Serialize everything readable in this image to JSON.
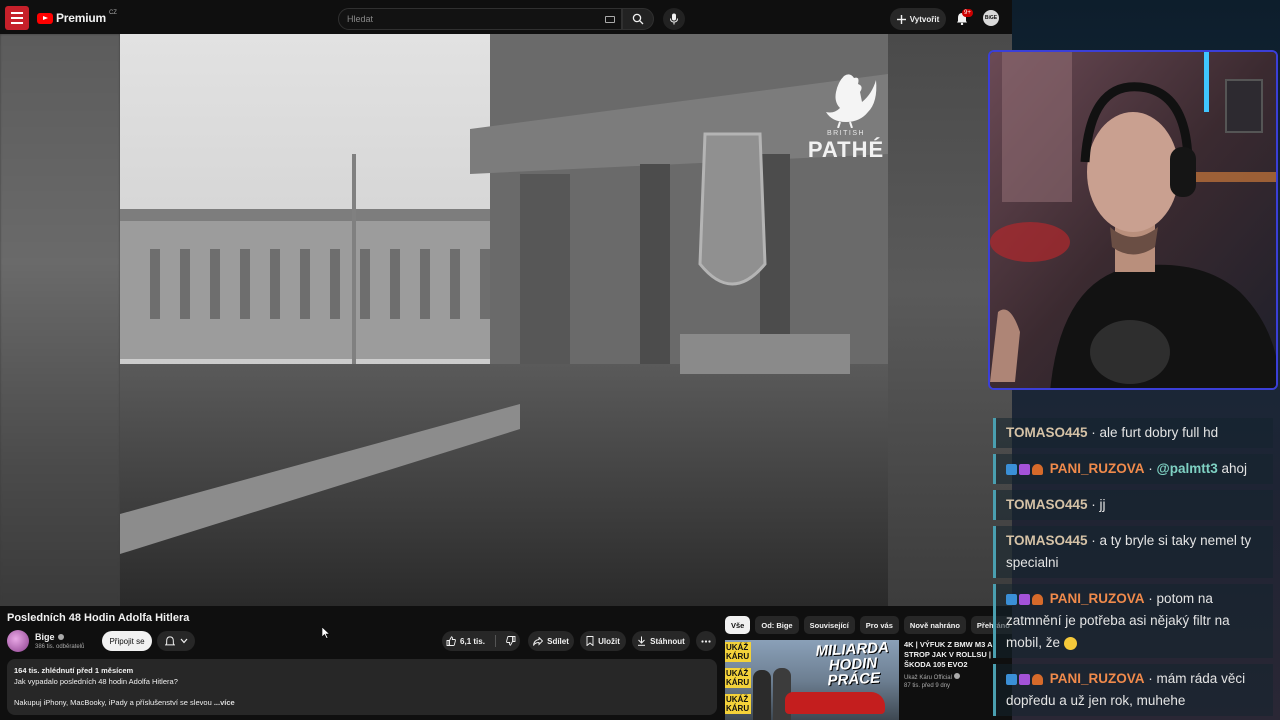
{
  "header": {
    "logo_text": "Premium",
    "region": "CZ",
    "search_placeholder": "Hledat",
    "create_label": "Vytvořit",
    "notif_count": "9+",
    "account_label": "BiGE"
  },
  "video": {
    "watermark_top": "BRITISH",
    "watermark_bottom": "PATHÉ",
    "title": "Posledních 48 Hodin Adolfa Hitlera"
  },
  "channel": {
    "name": "Bige",
    "subscribers": "386 tis. odběratelů",
    "join_label": "Připojit se"
  },
  "actions": {
    "likes": "6,1 tis.",
    "share": "Sdílet",
    "save": "Uložit",
    "download": "Stáhnout"
  },
  "description": {
    "meta": "164 tis. zhlédnutí  před 1 měsícem",
    "summary": "Jak vypadalo posledních 48 hodin Adolfa Hitlera?",
    "promo": "Nakupuj iPhony, MacBooky, iPady a příslušenství se slevou",
    "more": "...více"
  },
  "related": {
    "chips": [
      "Vše",
      "Od: Bige",
      "Související",
      "Pro vás",
      "Nově nahráno",
      "Přehráno"
    ],
    "thumb_tag": "UKÁŽ KÁRU",
    "thumb_headline": "MILIARDA HODIN PRÁCE",
    "title": "4K | VÝFUK Z BMW M3 A STROP JAK V ROLLSU | ŠKODA 105 EVO2",
    "channel": "Ukaž Káru Official",
    "stats": "87 tis.  před 9 dny"
  },
  "chat": [
    {
      "user": "TOMASO445",
      "user_class": "u-tomas",
      "badges": false,
      "mention": "",
      "text": "ale furt dobry full hd"
    },
    {
      "user": "PANI_RUZOVA",
      "user_class": "u-pani",
      "badges": true,
      "mention": "@palmtt3",
      "text": "ahoj"
    },
    {
      "user": "TOMASO445",
      "user_class": "u-tomas",
      "badges": false,
      "mention": "",
      "text": "jj"
    },
    {
      "user": "TOMASO445",
      "user_class": "u-tomas",
      "badges": false,
      "mention": "",
      "text": "a ty bryle si taky nemel ty specialni"
    },
    {
      "user": "PANI_RUZOVA",
      "user_class": "u-pani",
      "badges": true,
      "mention": "",
      "text": "potom na zatmnění je potřeba asi nějaký filtr na mobil, že"
    },
    {
      "user": "PANI_RUZOVA",
      "user_class": "u-pani",
      "badges": true,
      "mention": "",
      "text": "mám ráda věci dopředu a už jen rok, muhehe"
    }
  ]
}
